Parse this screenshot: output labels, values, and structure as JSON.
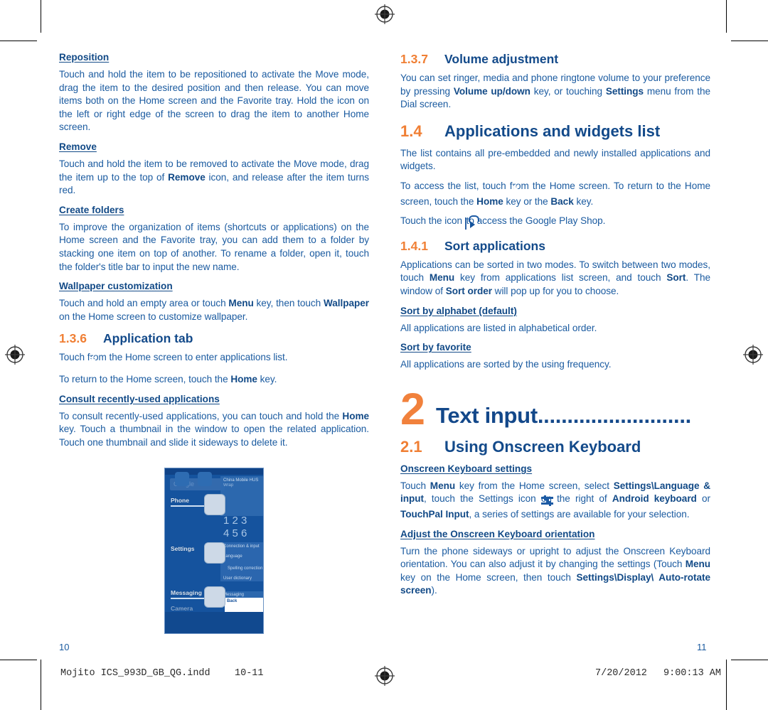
{
  "document": {
    "left_page_number": "10",
    "right_page_number": "11",
    "imprint_file": "Mojito ICS_993D_GB_QG.indd",
    "imprint_pages": "10-11",
    "imprint_date": "7/20/2012",
    "imprint_time": "9:00:13 AM"
  },
  "colors": {
    "body_blue": "#1b5ba0",
    "heading_blue": "#134a8a",
    "accent_orange": "#f07f34"
  },
  "left_column": {
    "reposition": {
      "heading": "Reposition ",
      "paragraph": "Touch and hold the item to be repositioned to activate the Move mode, drag the item to the desired position and then release. You can move items both on the Home screen and the Favorite tray. Hold the icon on the left or right edge of the screen to drag the item to another Home screen."
    },
    "remove": {
      "heading": "Remove",
      "p_part1": "Touch and hold the item to be removed to activate the Move mode, drag the item up to the top of ",
      "p_bold": "Remove",
      "p_part2": " icon, and release after the item turns red."
    },
    "create_folders": {
      "heading": "Create folders",
      "paragraph": "To improve the organization of items (shortcuts or applications) on the Home screen and the Favorite tray, you can add them to a folder by stacking one item on top of another. To rename a folder, open it, touch the folder's title bar to input the new name."
    },
    "wallpaper": {
      "heading": "Wallpaper customization",
      "p_part1": "Touch and hold an empty area or touch ",
      "p_bold1": "Menu",
      "p_part2": " key,  then touch ",
      "p_bold2": "Wallpaper",
      "p_part3": " on the Home screen to customize wallpaper."
    },
    "application_tab": {
      "number": "1.3.6",
      "title": "Application tab",
      "p1_part1": "Touch ",
      "p1_part2": " from the Home screen to enter applications list.",
      "p2_part1": "To return to the Home screen, touch the ",
      "p2_bold": "Home",
      "p2_part2": " key."
    },
    "consult_recent": {
      "heading": "Consult recently-used applications",
      "p_part1": "To consult recently-used applications, you can touch and hold the ",
      "p_bold": "Home",
      "p_part2": " key. Touch a thumbnail in the window to open the related application. Touch one thumbnail and slide it sideways to delete it."
    },
    "screenshot": {
      "search_placeholder": "Google",
      "app_phone": "Phone",
      "app_settings": "Settings",
      "app_messaging": "Messaging",
      "app_camera": "Camera",
      "carrier": "China Mobile HUS",
      "carrier_sub": "Wrap",
      "dial_row1": "1   2   3",
      "dial_row2": "4   5   6",
      "settings_item1": "Connection & input",
      "settings_item2": "Language",
      "settings_item3": "Spelling correction",
      "settings_item4": "User dictionary",
      "messaging_title": "Messaging",
      "messaging_item": "Back"
    }
  },
  "right_column": {
    "volume": {
      "number": "1.3.7",
      "title": "Volume adjustment",
      "p_part1": "You can set ringer, media and phone ringtone volume to your preference by pressing ",
      "p_bold1": "Volume up/down",
      "p_part2": " key, or touching ",
      "p_bold2": "Settings",
      "p_part3": " menu from the Dial screen."
    },
    "apps_widgets": {
      "number": "1.4",
      "title": "Applications and widgets list",
      "p1": "The list contains all pre-embedded and newly installed applications and widgets.",
      "p2_part1": "To access the list, touch ",
      "p2_part2": " from the Home screen. To return to the Home screen, touch the ",
      "p2_bold1": "Home",
      "p2_part3": " key or the ",
      "p2_bold2": "Back",
      "p2_part4": " key.",
      "p3_part1": "Touch the icon ",
      "p3_part2": " to access the Google Play Shop."
    },
    "sort_applications": {
      "number": "1.4.1",
      "title": "Sort applications",
      "p_part1": "Applications can be sorted in two modes. To switch between two modes, touch ",
      "p_bold1": "Menu",
      "p_part2": " key from applications list screen, and touch ",
      "p_bold2": "Sort",
      "p_part3": ". The window of ",
      "p_bold3": "Sort order",
      "p_part4": " will pop up for you to choose."
    },
    "sort_alphabet": {
      "heading": "Sort by alphabet  (default)",
      "paragraph": "All applications are listed in alphabetical order."
    },
    "sort_favorite": {
      "heading": "Sort by favorite ",
      "paragraph": "All applications are sorted by the using frequency."
    },
    "chapter": {
      "number": "2",
      "title": "Text input",
      "leader": ".........................."
    },
    "using_keyboard": {
      "number": "2.1",
      "title": "Using Onscreen Keyboard"
    },
    "keyboard_settings": {
      "heading": "Onscreen Keyboard settings",
      "p_part1": "Touch ",
      "p_bold1": "Menu",
      "p_part2": " key from the Home screen, select ",
      "p_bold2": "Settings\\Language & input",
      "p_part3": ", touch the Settings icon ",
      "p_part4": " on the right of ",
      "p_bold3": "Android keyboard",
      "p_part5": " or ",
      "p_bold4": "TouchPal Input",
      "p_part6": ", a series of settings are available for your selection."
    },
    "keyboard_orientation": {
      "heading": "Adjust the Onscreen Keyboard orientation",
      "p_part1": "Turn the phone sideways or upright to adjust the Onscreen Keyboard orientation. You can also adjust it by changing the settings (Touch ",
      "p_bold1": "Menu",
      "p_part2": " key on the  Home screen, then touch ",
      "p_bold2": "Settings\\Display\\ Auto-rotate screen",
      "p_part3": ")."
    }
  },
  "icons": {
    "app_drawer": "app-drawer-icon",
    "play_store": "play-store-icon",
    "settings_sliders": "settings-sliders-icon",
    "registration_mark": "registration-target-icon"
  }
}
